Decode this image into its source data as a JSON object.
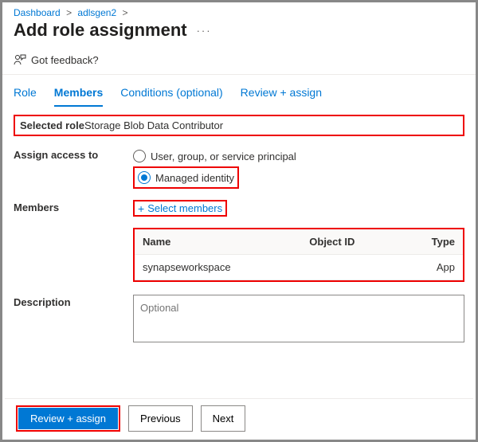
{
  "breadcrumb": {
    "items": [
      "Dashboard",
      "adlsgen2"
    ],
    "sep": ">"
  },
  "title": "Add role assignment",
  "feedback": "Got feedback?",
  "tabs": {
    "items": [
      "Role",
      "Members",
      "Conditions (optional)",
      "Review + assign"
    ],
    "activeIndex": 1
  },
  "selectedRole": {
    "label": "Selected role",
    "value": "Storage Blob Data Contributor"
  },
  "assignAccess": {
    "label": "Assign access to",
    "options": [
      {
        "label": "User, group, or service principal",
        "checked": false
      },
      {
        "label": "Managed identity",
        "checked": true
      }
    ]
  },
  "members": {
    "label": "Members",
    "selectLink": "Select members",
    "columns": [
      "Name",
      "Object ID",
      "Type"
    ],
    "rows": [
      {
        "name": "synapseworkspace",
        "objectId": "",
        "type": "App"
      }
    ]
  },
  "description": {
    "label": "Description",
    "placeholder": "Optional"
  },
  "footer": {
    "primary": "Review + assign",
    "previous": "Previous",
    "next": "Next"
  }
}
